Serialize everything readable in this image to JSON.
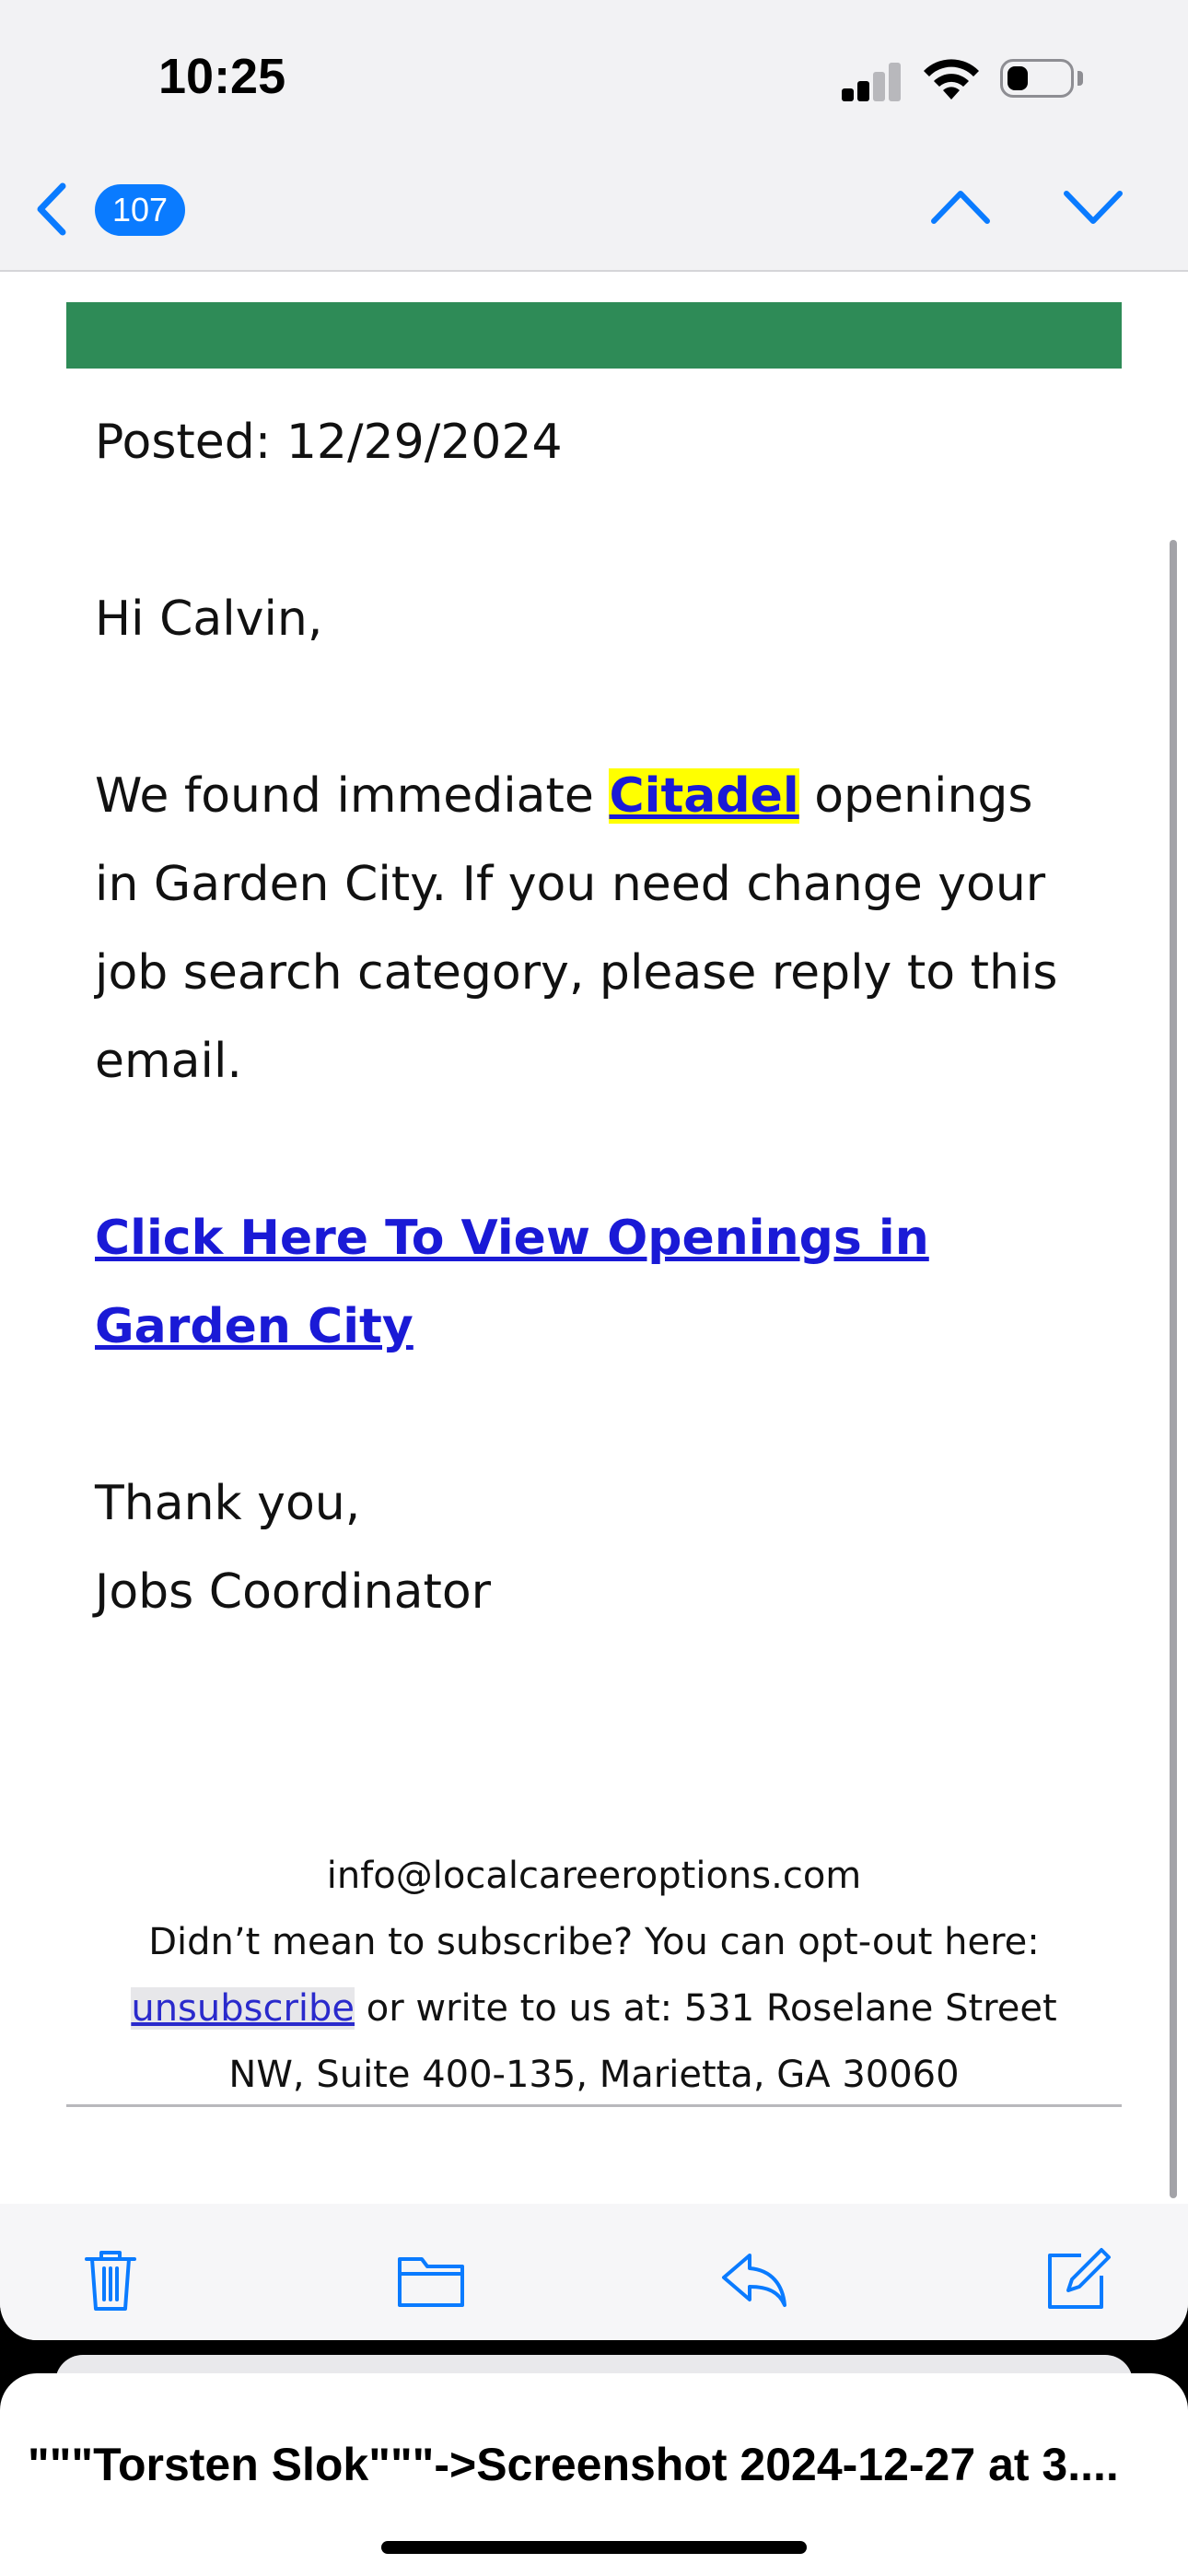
{
  "status_bar": {
    "time": "10:25",
    "signal_bars_filled": 2,
    "battery_level": 0.3
  },
  "nav": {
    "unread_count": "107",
    "back_icon": "chevron-left-icon",
    "prev_icon": "chevron-up-icon",
    "next_icon": "chevron-down-icon"
  },
  "email": {
    "banner_color": "#2e8b57",
    "posted": "Posted: 12/29/2024",
    "greeting": "Hi Calvin,",
    "para_prefix": "We found immediate ",
    "company": "Citadel",
    "para_suffix": " openings in Garden City. If you need change your job search category, please reply to this email.",
    "cta_link": "Click Here To View Openings in Garden City",
    "thank_you": "Thank you,",
    "signature": "Jobs Coordinator",
    "footer": {
      "email": "info@localcareeroptions.com",
      "optout_text": "Didn’t mean to subscribe? You can opt-out here: ",
      "unsubscribe_link": "unsubscribe",
      "address_text": " or write to us at: 531 Roselane Street NW, Suite 400-135, Marietta, GA 30060"
    }
  },
  "toolbar": {
    "items": [
      "trash-icon",
      "folder-icon",
      "reply-icon",
      "compose-icon"
    ],
    "accent_color": "#0a7bff"
  },
  "share_card": {
    "title": "\"\"\"Torsten Slok\"\"\"->Screenshot 2024-12-27 at 3...."
  }
}
